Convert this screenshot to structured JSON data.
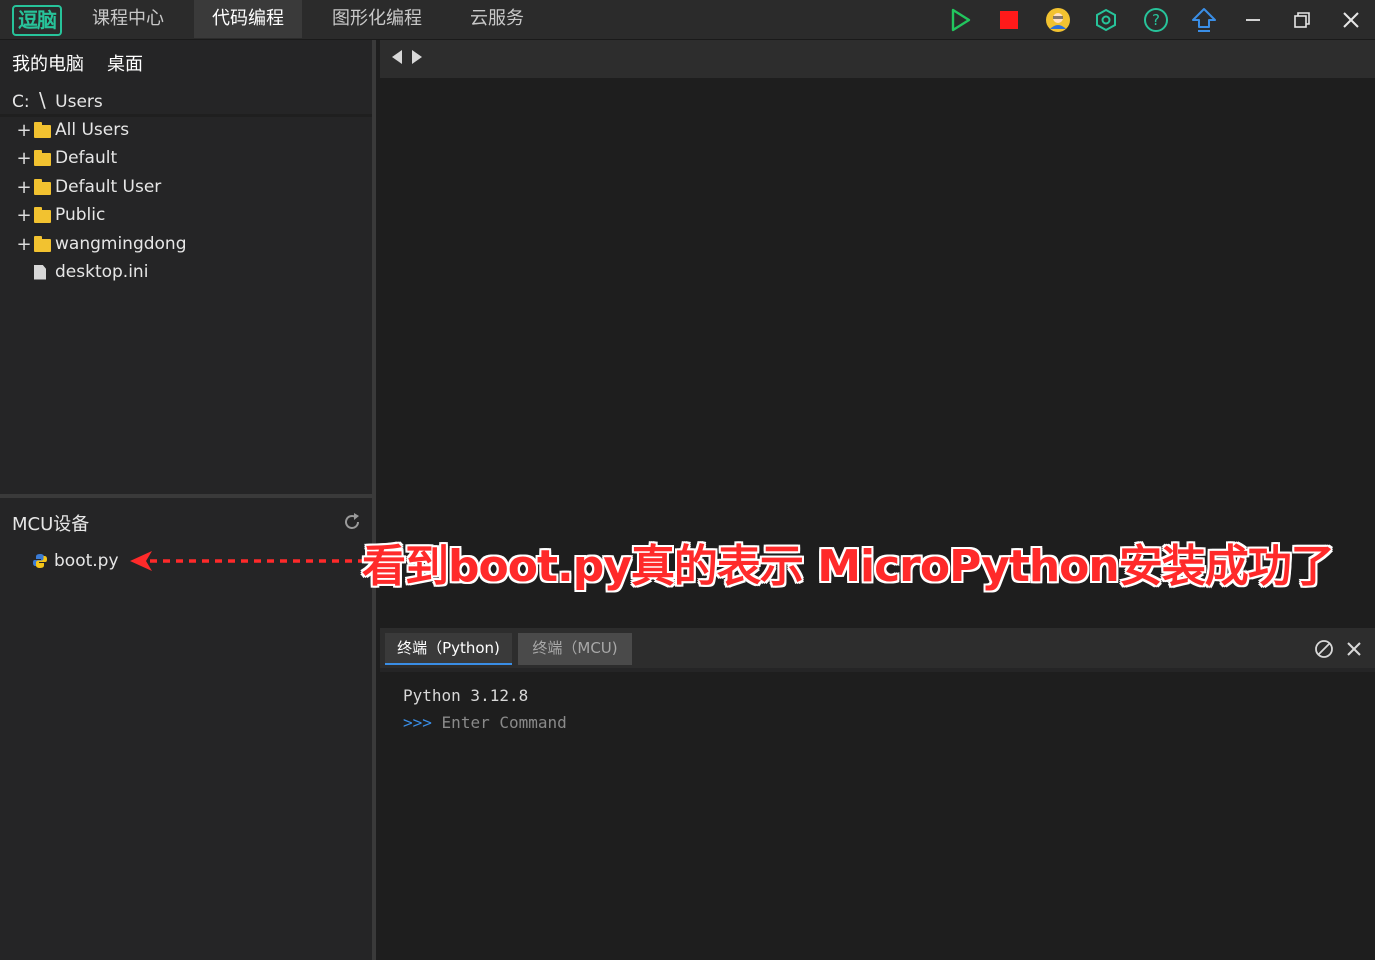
{
  "app": {
    "logo_text": "逗脑",
    "nav_tabs": [
      "课程中心",
      "代码编程",
      "图形化编程",
      "云服务"
    ],
    "active_tab": "代码编程"
  },
  "toolbar_icons": [
    "run-icon",
    "stop-icon",
    "avatar-icon",
    "settings-hex-icon",
    "help-icon",
    "upload-icon",
    "minimize-icon",
    "restore-icon",
    "close-icon"
  ],
  "colors": {
    "accent_green": "#27c39a",
    "run_green": "#22c55e",
    "stop_red": "#ff1a1a",
    "annotation_red": "#ff2a2a",
    "tab_blue": "#3a8ee6"
  },
  "file_panel": {
    "tabs": [
      "我的电脑",
      "桌面"
    ],
    "path": {
      "drive": "C:",
      "sep": "\\",
      "folder": "Users"
    },
    "items": [
      {
        "name": "All Users",
        "type": "folder"
      },
      {
        "name": "Default",
        "type": "folder"
      },
      {
        "name": "Default User",
        "type": "folder"
      },
      {
        "name": "Public",
        "type": "folder"
      },
      {
        "name": "wangmingdong",
        "type": "folder"
      },
      {
        "name": "desktop.ini",
        "type": "file"
      }
    ]
  },
  "mcu": {
    "title": "MCU设备",
    "files": [
      {
        "name": "boot.py"
      }
    ]
  },
  "terminal": {
    "tabs": [
      "终端（Python)",
      "终端（MCU)"
    ],
    "active": 0,
    "version_line": "Python 3.12.8",
    "prompt": ">>>",
    "placeholder": "Enter Command"
  },
  "annotation": {
    "text": "看到boot.py真的表示 MicroPython安装成功了"
  }
}
